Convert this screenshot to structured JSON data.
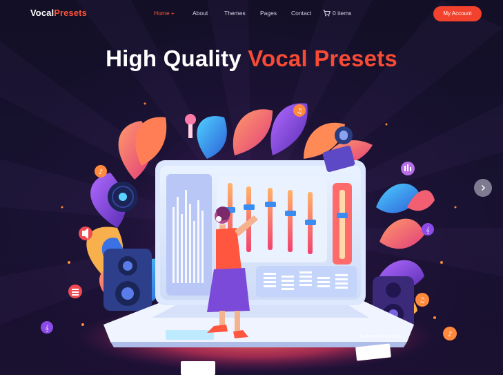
{
  "brand": {
    "part1": "Vocal",
    "part2": "Presets"
  },
  "nav": {
    "items": [
      {
        "label": "Home +",
        "active": true
      },
      {
        "label": "About",
        "active": false
      },
      {
        "label": "Themes",
        "active": false
      },
      {
        "label": "Pages",
        "active": false
      },
      {
        "label": "Contact",
        "active": false
      }
    ],
    "cart_label": "0 items",
    "cart_icon": "cart-icon",
    "account_label": "My Account"
  },
  "hero": {
    "title_part1": "High Quality",
    "title_part2": "Vocal Presets",
    "next_icon": "chevron-right-icon",
    "image_credit": "illustration@zahidul"
  },
  "colors": {
    "accent": "#f2412d",
    "title_accent": "#f84a34",
    "background": "#15112b"
  }
}
